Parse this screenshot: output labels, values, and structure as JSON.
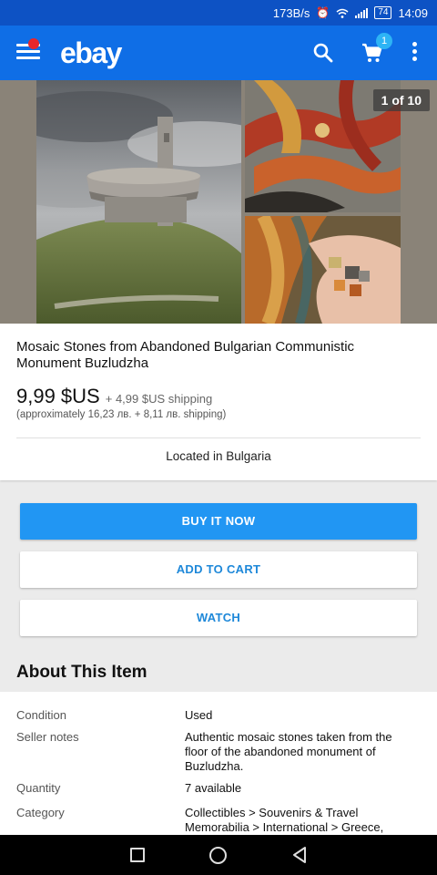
{
  "status_bar": {
    "speed": "173B/s",
    "battery": "74",
    "time": "14:09"
  },
  "app_bar": {
    "logo": "ebay",
    "cart_count": "1",
    "brand_color": "#0f6ee6"
  },
  "gallery": {
    "counter": "1 of 10"
  },
  "item": {
    "title": "Mosaic Stones from Abandoned Bulgarian Communistic Monument Buzludzha",
    "price": "9,99 $US",
    "shipping": "+ 4,99 $US shipping",
    "approx": "(approximately 16,23 лв. + 8,11 лв. shipping)",
    "location": "Located in Bulgaria"
  },
  "actions": {
    "buy": "BUY IT NOW",
    "cart": "ADD TO CART",
    "watch": "WATCH",
    "primary_color": "#2196f3"
  },
  "about": {
    "heading": "About This Item",
    "rows": [
      {
        "label": "Condition",
        "value": "Used"
      },
      {
        "label": "Seller notes",
        "value": "Authentic mosaic stones taken from the floor of the abandoned monument of Buzludzha."
      },
      {
        "label": "Quantity",
        "value": "7 available"
      },
      {
        "label": "Category",
        "value": "Collectibles > Souvenirs & Travel Memorabilia > International > Greece,"
      }
    ]
  },
  "icons": {
    "menu": "hamburger-icon",
    "search": "search-icon",
    "cart": "cart-icon",
    "more": "more-vert-icon",
    "recents": "square-icon",
    "home": "circle-icon",
    "back": "triangle-back-icon"
  }
}
